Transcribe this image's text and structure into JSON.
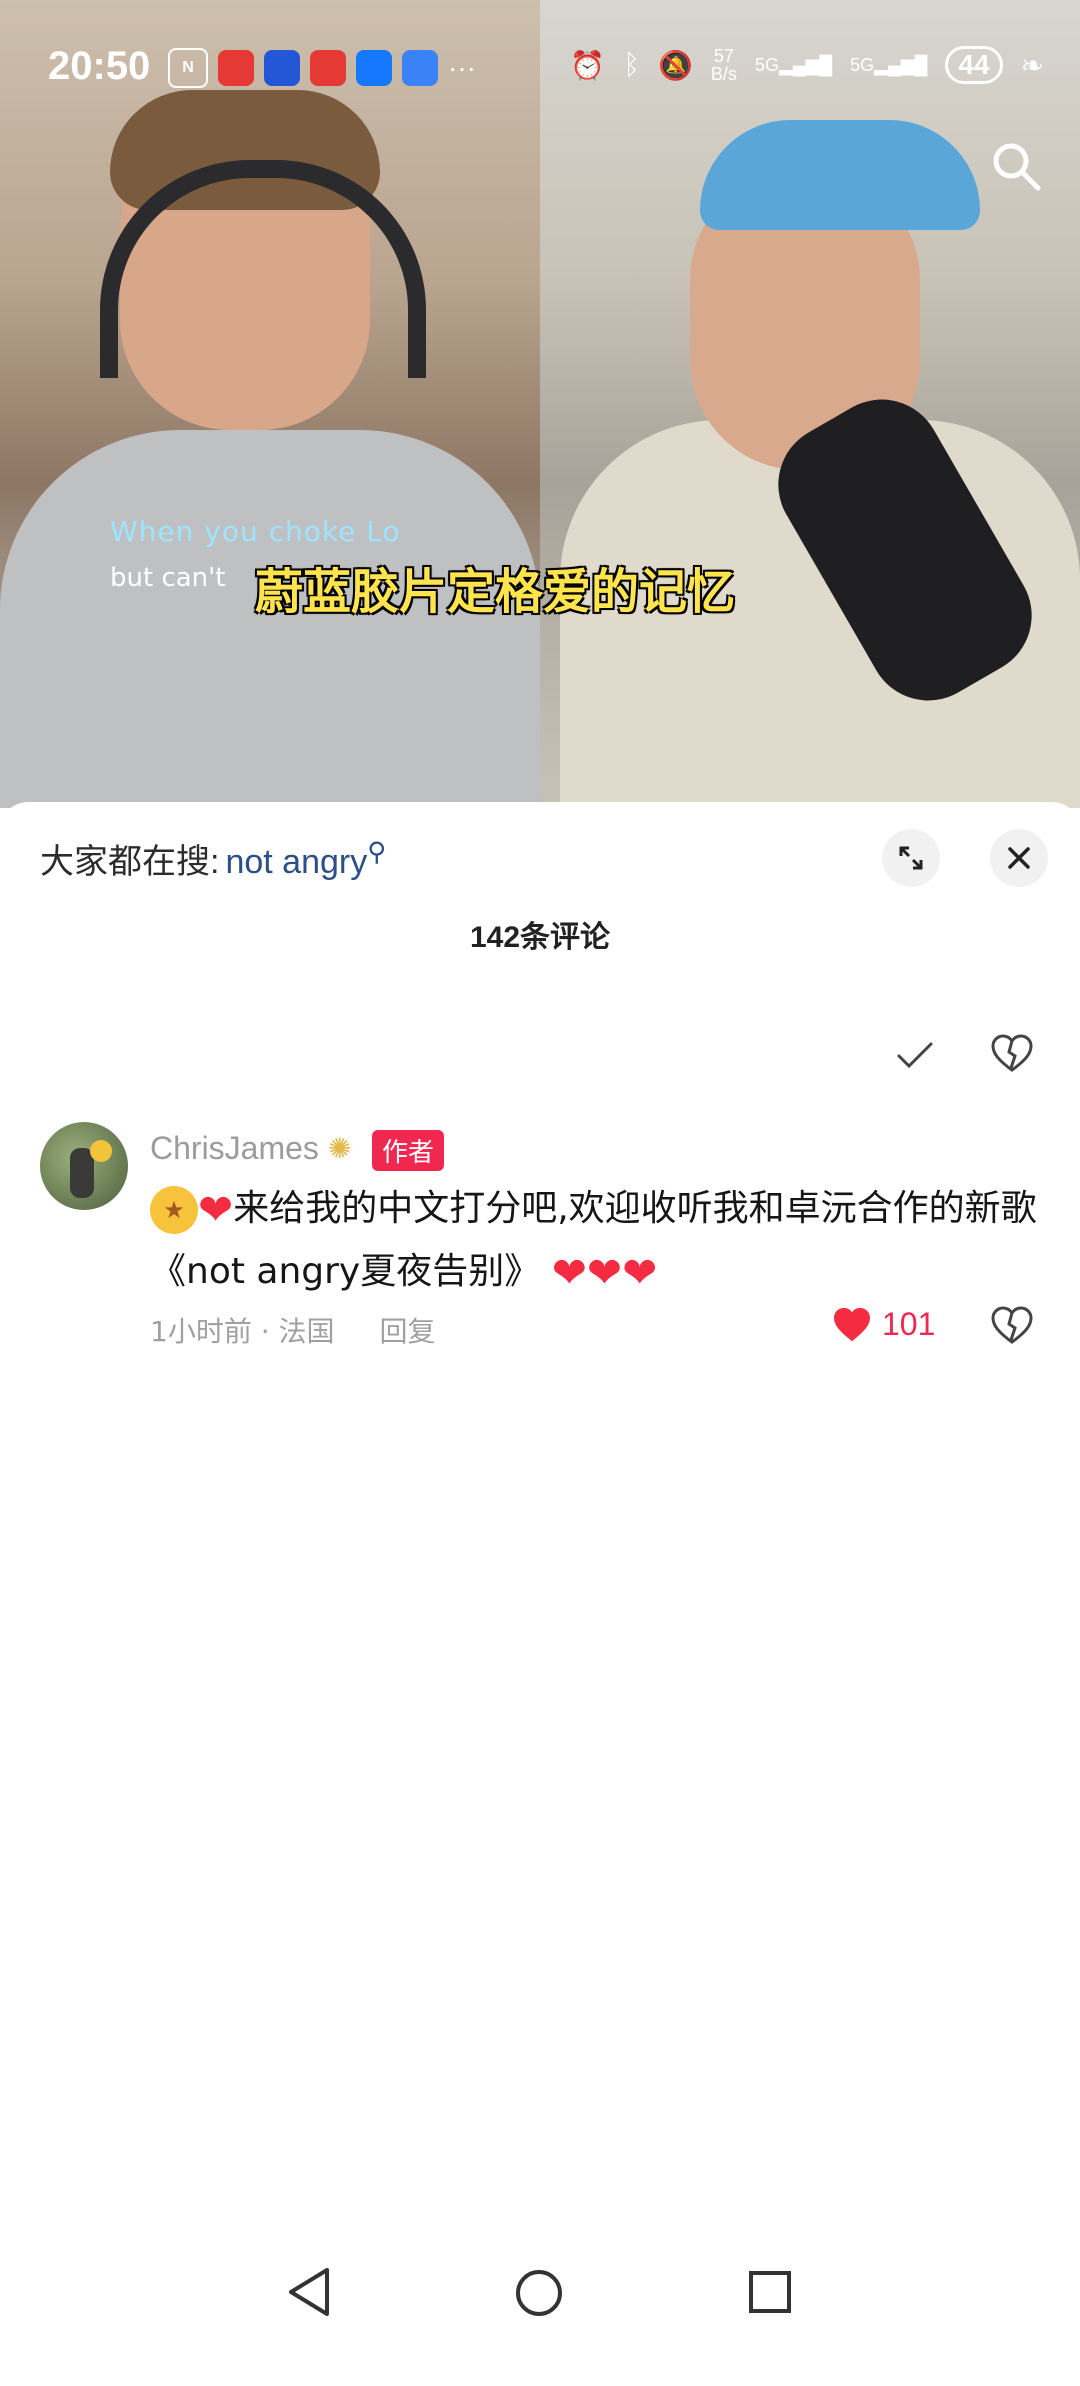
{
  "status_bar": {
    "time": "20:50",
    "net_speed_top": "57",
    "net_speed_bottom": "B/s",
    "signal1": "5G",
    "signal2": "5G",
    "battery": "44"
  },
  "video": {
    "overlay_en_line1": "When you choke Lo",
    "overlay_en_line2": "but can't",
    "subtitle": "蔚蓝胶片定格爱的记忆"
  },
  "panel": {
    "hot_search_label": "大家都在搜:",
    "hot_search_query": "not angry",
    "comment_count": "142条评论"
  },
  "comment": {
    "username": "ChrisJames",
    "author_badge": "作者",
    "text": "来给我的中文打分吧,欢迎收听我和卓沅合作的新歌《not angry夏夜告别》",
    "time": "1小时前",
    "location": "法国",
    "reply_label": "回复",
    "likes": "101"
  },
  "icons": [
    "search-icon",
    "expand-icon",
    "close-icon",
    "check-icon",
    "heart-icon",
    "dislike-icon",
    "nav-back-icon",
    "nav-home-icon",
    "nav-recent-icon"
  ],
  "colors": {
    "accent": "#f0284f",
    "link": "#2b4f86",
    "subtitle": "#ffe44d"
  }
}
